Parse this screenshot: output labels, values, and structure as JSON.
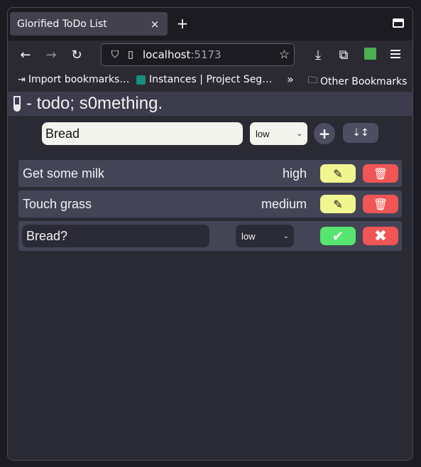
{
  "browser": {
    "tab_title": "Glorified ToDo List",
    "tab_close": "×",
    "new_tab": "+",
    "url_host": "localhost",
    "url_port": ":5173",
    "icons": {
      "back": "arrow-left-icon",
      "forward": "arrow-right-icon",
      "reload": "reload-icon",
      "shield": "shield-icon",
      "page": "page-icon",
      "star": "star-icon",
      "download": "download-icon",
      "extensions": "puzzle-icon",
      "menu": "hamburger-menu-icon"
    }
  },
  "bookmarks": {
    "import": "Import bookmarks…",
    "instances": "Instances | Project Seg…",
    "overflow": "»",
    "other": "Other Bookmarks"
  },
  "page": {
    "title": "- todo; s0mething."
  },
  "add_form": {
    "input_value": "Bread",
    "priority": "low",
    "add_label": "+",
    "sort_label": "⇣↕"
  },
  "todos": [
    {
      "text": "Get some milk",
      "priority": "high"
    },
    {
      "text": "Touch grass",
      "priority": "medium"
    }
  ],
  "editing": {
    "input_value": "Bread?",
    "priority": "low",
    "confirm_label": "✔",
    "cancel_label": "✖"
  },
  "colors": {
    "edit": "#f0f590",
    "delete": "#f25555",
    "confirm": "#56e56e",
    "item_bg": "#444457"
  }
}
